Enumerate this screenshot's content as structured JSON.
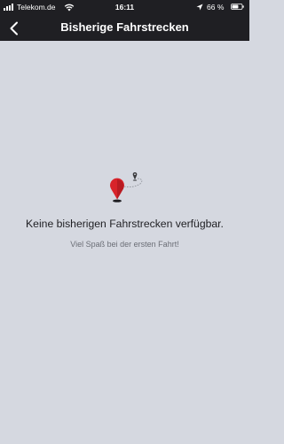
{
  "status_bar": {
    "carrier": "Telekom.de",
    "time": "16:11",
    "battery_percent": "66 %",
    "battery_level": 0.66,
    "icons": [
      "signal-icon",
      "wifi-icon",
      "location-arrow-icon",
      "battery-icon"
    ]
  },
  "nav": {
    "back_icon": "chevron-left-icon",
    "title": "Bisherige Fahrstrecken"
  },
  "empty_state": {
    "illustration": "map-pin-route-icon",
    "title": "Keine bisherigen Fahrstrecken verfügbar.",
    "subtitle": "Viel Spaß bei der ersten Fahrt!"
  },
  "colors": {
    "background": "#d5d8e0",
    "bar": "#1f1f23",
    "pin_red": "#d8232a",
    "pin_dark": "#3a3a3d"
  }
}
